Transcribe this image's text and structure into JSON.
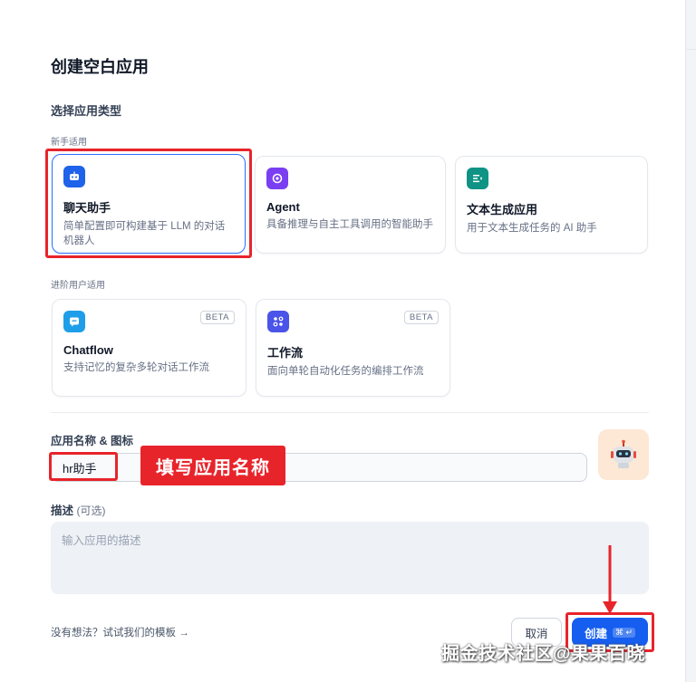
{
  "dialog": {
    "title": "创建空白应用",
    "section_type": "选择应用类型"
  },
  "groups": {
    "beginner": "新手适用",
    "advanced": "进阶用户适用"
  },
  "app_types": [
    {
      "name": "聊天助手",
      "desc": "简单配置即可构建基于 LLM 的对话机器人",
      "icon": "chat-bot-icon",
      "color": "#1e63e9",
      "selected": true
    },
    {
      "name": "Agent",
      "desc": "具备推理与自主工具调用的智能助手",
      "icon": "agent-icon",
      "color": "#7a3ff2"
    },
    {
      "name": "文本生成应用",
      "desc": "用于文本生成任务的 AI 助手",
      "icon": "text-gen-icon",
      "color": "#0e9384"
    },
    {
      "name": "Chatflow",
      "desc": "支持记忆的复杂多轮对话工作流",
      "icon": "chatflow-icon",
      "color": "#1e9ee9",
      "badge": "BETA"
    },
    {
      "name": "工作流",
      "desc": "面向单轮自动化任务的编排工作流",
      "icon": "workflow-icon",
      "color": "#4b54e8",
      "badge": "BETA"
    }
  ],
  "form": {
    "name_label": "应用名称 & 图标",
    "name_value": "hr助手",
    "desc_label": "描述",
    "desc_optional": "(可选)",
    "desc_placeholder": "输入应用的描述"
  },
  "footer": {
    "template_link": "没有想法？试试我们的模板 →",
    "cancel": "取消",
    "create": "创建",
    "create_kbd": "⌘ ↵"
  },
  "annotations": {
    "tag_text": "填写应用名称",
    "highlight_color": "#e8242b"
  },
  "watermark": "掘金技术社区@果果百晓"
}
